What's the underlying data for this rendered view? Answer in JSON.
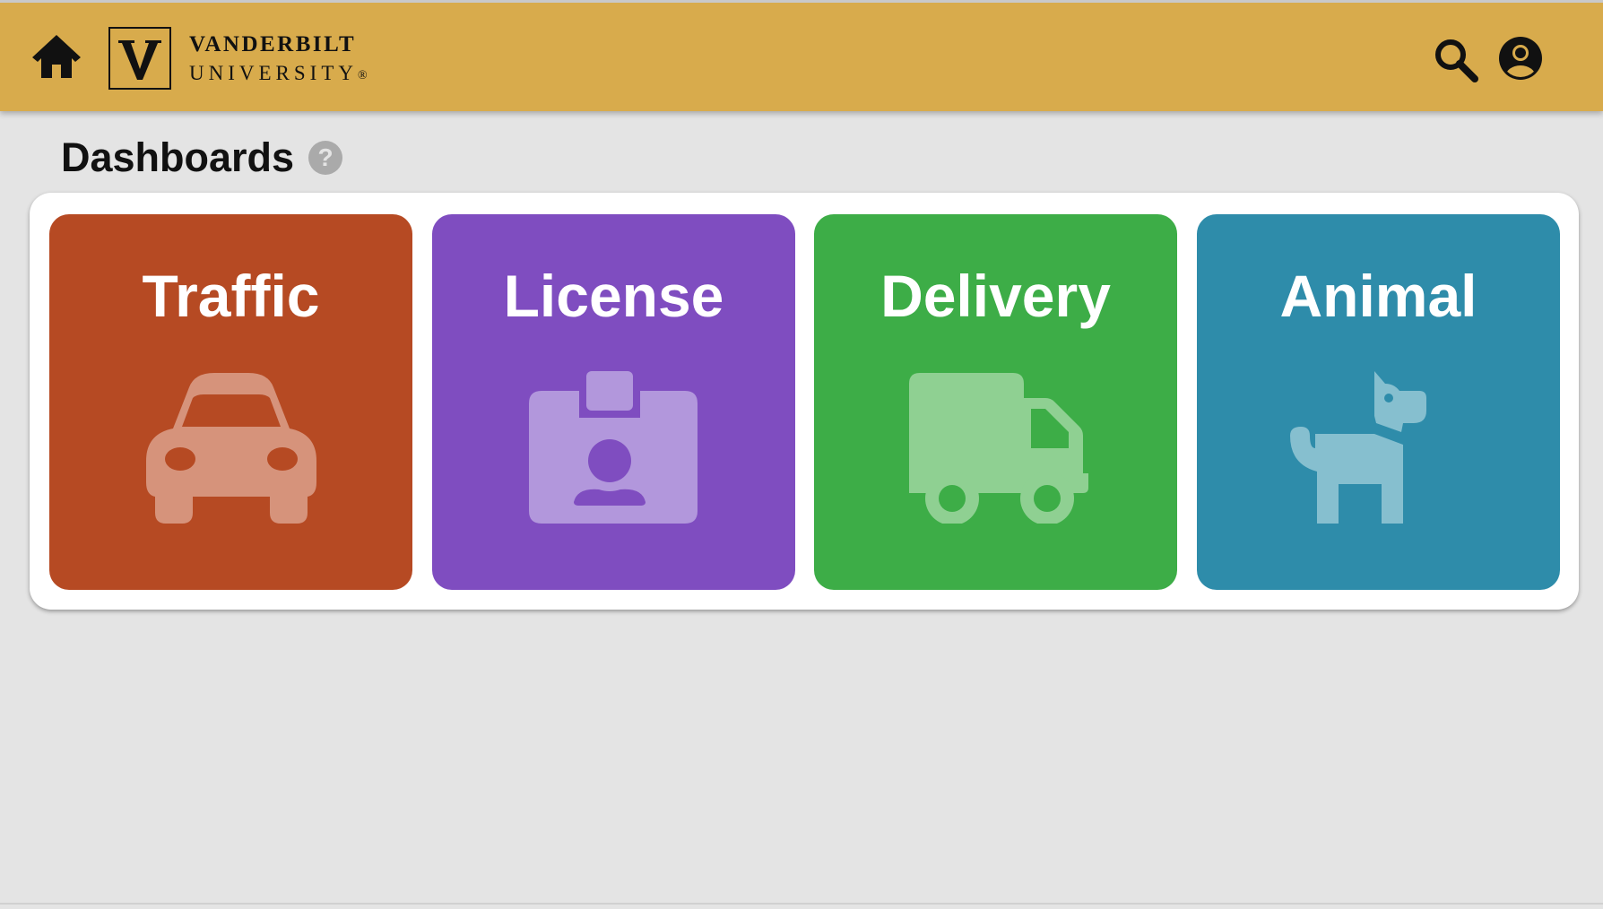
{
  "header": {
    "logo_line1": "VANDERBILT",
    "logo_line2": "UNIVERSITY",
    "logo_reg": "®",
    "bar_color": "#d8ab4c",
    "icons": {
      "home": "home-icon",
      "search": "search-icon",
      "account": "account-icon"
    }
  },
  "page": {
    "title": "Dashboards",
    "help_glyph": "?"
  },
  "tiles": [
    {
      "label": "Traffic",
      "icon": "car-icon",
      "color": "#b64a23",
      "icon_color": "#d6937b"
    },
    {
      "label": "License",
      "icon": "id-badge-icon",
      "color": "#7f4dc0",
      "icon_color": "#b297dc"
    },
    {
      "label": "Delivery",
      "icon": "truck-icon",
      "color": "#3dad47",
      "icon_color": "#8fd092"
    },
    {
      "label": "Animal",
      "icon": "dog-icon",
      "color": "#2e8caa",
      "icon_color": "#86bfcf"
    }
  ]
}
